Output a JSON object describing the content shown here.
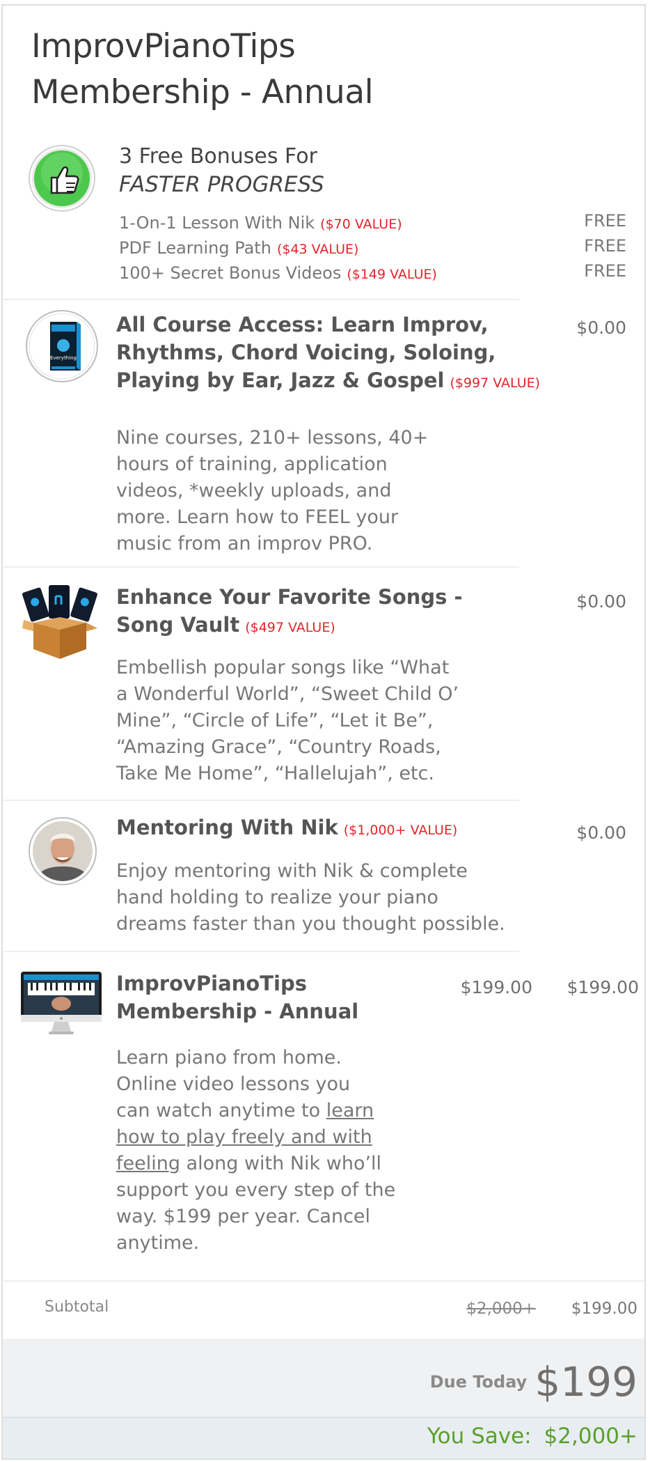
{
  "title_line1": "ImprovPianoTips",
  "title_line2": "Membership - Annual",
  "bonuses": {
    "heading": "3 Free Bonuses For",
    "heading_italic": "FASTER PROGRESS",
    "items": [
      {
        "label": "1-On-1 Lesson With Nik",
        "value": "($70 VALUE)",
        "price": "FREE"
      },
      {
        "label": "PDF Learning Path",
        "value": "($43 VALUE)",
        "price": "FREE"
      },
      {
        "label": "100+ Secret Bonus Videos",
        "value": "($149 VALUE)",
        "price": "FREE"
      }
    ]
  },
  "items": [
    {
      "title_lines": [
        "All Course Access: Learn Improv,",
        "Rhythms, Chord Voicing, Soloing,",
        "Playing by Ear, Jazz & Gospel"
      ],
      "value": "($997 VALUE)",
      "price": "$0.00",
      "desc_lines": [
        "Nine courses, 210+ lessons, 40+",
        "hours of training, application",
        "videos, *weekly uploads, and",
        "more. Learn how to FEEL your",
        "music from an improv PRO."
      ]
    },
    {
      "title_lines": [
        "Enhance Your Favorite Songs -",
        "Song Vault"
      ],
      "value": "($497 VALUE)",
      "price": "$0.00",
      "desc_lines": [
        "Embellish popular songs like “What",
        "a Wonderful World”, “Sweet Child O’",
        "Mine”, “Circle of Life”, “Let it Be”,",
        "“Amazing Grace”, “Country Roads,",
        "Take Me Home”, “Hallelujah”, etc."
      ]
    },
    {
      "title_lines": [
        "Mentoring With Nik"
      ],
      "value": "($1,000+ VALUE)",
      "price": "$0.00",
      "desc_lines": [
        "Enjoy mentoring with Nik & complete",
        "hand holding to realize your piano",
        "dreams faster than you thought possible."
      ]
    },
    {
      "title_lines": [
        "ImprovPianoTips",
        "Membership - Annual"
      ],
      "unit_price": "$199.00",
      "price": "$199.00",
      "desc": {
        "l1": "Learn piano from home.",
        "l2": "Online video lessons you",
        "l3a": "can watch anytime to ",
        "l3b": "learn",
        "l4": "how to play freely and with",
        "l5a": "feeling",
        "l5b": " along with Nik who’ll",
        "l6": "support you every step of the",
        "l7": "way. $199 per year. Cancel",
        "l8": "anytime."
      }
    }
  ],
  "subtotal": {
    "label": "Subtotal",
    "original": "$2,000+",
    "amount": "$199.00"
  },
  "due_today": {
    "label": "Due Today",
    "amount": "$199"
  },
  "you_save": {
    "label": "You Save:",
    "amount": "$2,000+"
  },
  "colors": {
    "value_red": "#e3242b",
    "save_green": "#5aa02c",
    "thumb_green": "#4cc94c"
  },
  "icons": [
    "thumbs-up-icon",
    "course-box-icon",
    "song-vault-box-icon",
    "mentor-avatar-icon",
    "imac-icon"
  ]
}
